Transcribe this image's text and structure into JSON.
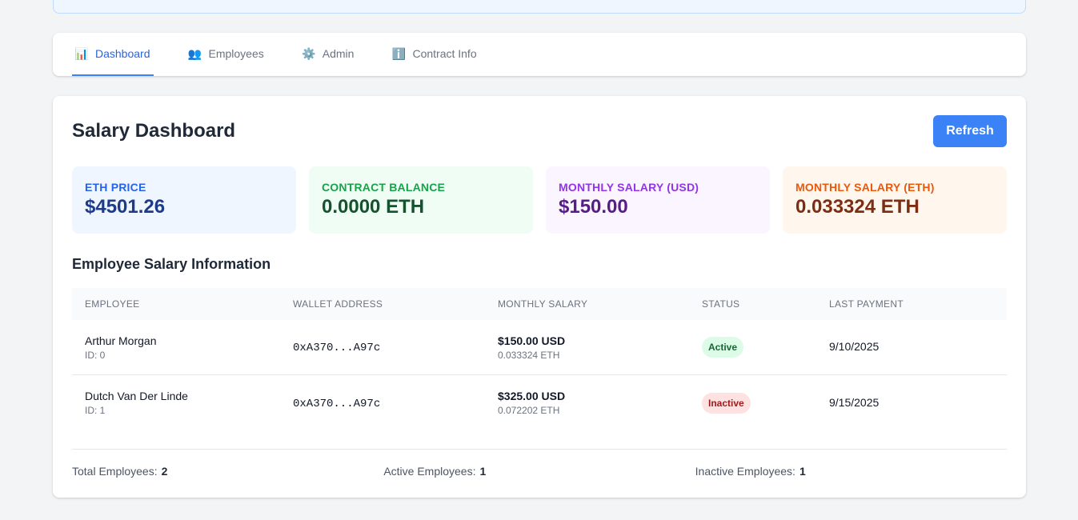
{
  "tabs": [
    {
      "icon": "📊",
      "icon_name": "bar-chart-icon",
      "label": "Dashboard",
      "active": true
    },
    {
      "icon": "👥",
      "icon_name": "people-icon",
      "label": "Employees",
      "active": false
    },
    {
      "icon": "⚙️",
      "icon_name": "gear-icon",
      "label": "Admin",
      "active": false
    },
    {
      "icon": "ℹ️",
      "icon_name": "info-icon",
      "label": "Contract Info",
      "active": false
    }
  ],
  "dashboard": {
    "title": "Salary Dashboard",
    "refresh_label": "Refresh"
  },
  "stats": [
    {
      "label": "ETH PRICE",
      "value": "$4501.26",
      "color": "#2563eb"
    },
    {
      "label": "CONTRACT BALANCE",
      "value": "0.0000 ETH",
      "color": "#16a34a"
    },
    {
      "label": "MONTHLY SALARY (USD)",
      "value": "$150.00",
      "color": "#9333ea"
    },
    {
      "label": "MONTHLY SALARY (ETH)",
      "value": "0.033324 ETH",
      "color": "#ea580c"
    }
  ],
  "table": {
    "title": "Employee Salary Information",
    "columns": [
      "EMPLOYEE",
      "WALLET ADDRESS",
      "MONTHLY SALARY",
      "STATUS",
      "LAST PAYMENT"
    ],
    "rows": [
      {
        "name": "Arthur Morgan",
        "id": "ID: 0",
        "wallet": "0xA370...A97c",
        "salary_usd": "$150.00 USD",
        "salary_eth": "0.033324 ETH",
        "status": "Active",
        "last_payment": "9/10/2025"
      },
      {
        "name": "Dutch Van Der Linde",
        "id": "ID: 1",
        "wallet": "0xA370...A97c",
        "salary_usd": "$325.00 USD",
        "salary_eth": "0.072202 ETH",
        "status": "Inactive",
        "last_payment": "9/15/2025"
      }
    ]
  },
  "summary": {
    "total_label": "Total Employees:",
    "total_value": "2",
    "active_label": "Active Employees:",
    "active_value": "1",
    "inactive_label": "Inactive Employees:",
    "inactive_value": "1"
  }
}
